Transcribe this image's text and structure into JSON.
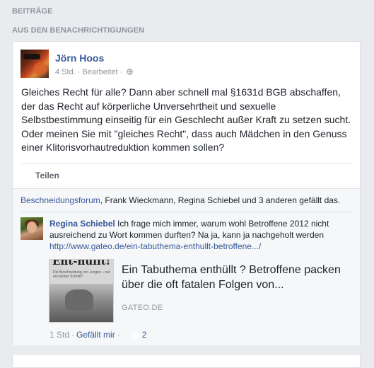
{
  "sections": {
    "beitraege": "BEITRÄGE",
    "benachrichtigungen": "AUS DEN BENACHRICHTIGUNGEN"
  },
  "post": {
    "author": "Jörn Hoos",
    "time": "4 Std.",
    "edited": "Bearbeitet",
    "privacy_icon": "globe-icon",
    "text": "Gleiches Recht für alle? Dann aber schnell mal §1631d BGB abschaffen, der das Recht auf körperliche Unversehrtheit und sexuelle Selbstbestimmung einseitig für ein Geschlecht außer Kraft zu setzen sucht. Oder meinen Sie mit \"gleiches Recht\", dass auch Mädchen in den Genuss einer Klitorisvorhautreduktion kommen sollen?",
    "share_label": "Teilen"
  },
  "likes": {
    "page_link": "Beschneidungsforum",
    "rest": ", Frank Wieckmann, Regina Schiebel und 3 anderen gefällt das."
  },
  "comment": {
    "author": "Regina Schiebel",
    "text": "Ich frage mich immer, warum wohl Betroffene 2012 nicht ausreichend zu Wort kommen durften? Na ja, kann ja nachgeholt werden",
    "link": "http://www.gateo.de/ein-tabuthema-enthullt-betroffene.../",
    "preview": {
      "thumb_title": "Ent-hüllt!",
      "thumb_sub": "Die Beschneidung von Jungen – nur ein kleiner Schnitt?",
      "title": "Ein Tabuthema enthüllt ? Betroffene packen über die oft fatalen Folgen von...",
      "domain": "GATEO.DE"
    },
    "time": "1 Std",
    "like_label": "Gefällt mir",
    "like_count": "2",
    "like_icon": "thumbs-up-icon"
  },
  "colors": {
    "link": "#365899",
    "meta": "#90949c",
    "background": "#e9ebee"
  }
}
